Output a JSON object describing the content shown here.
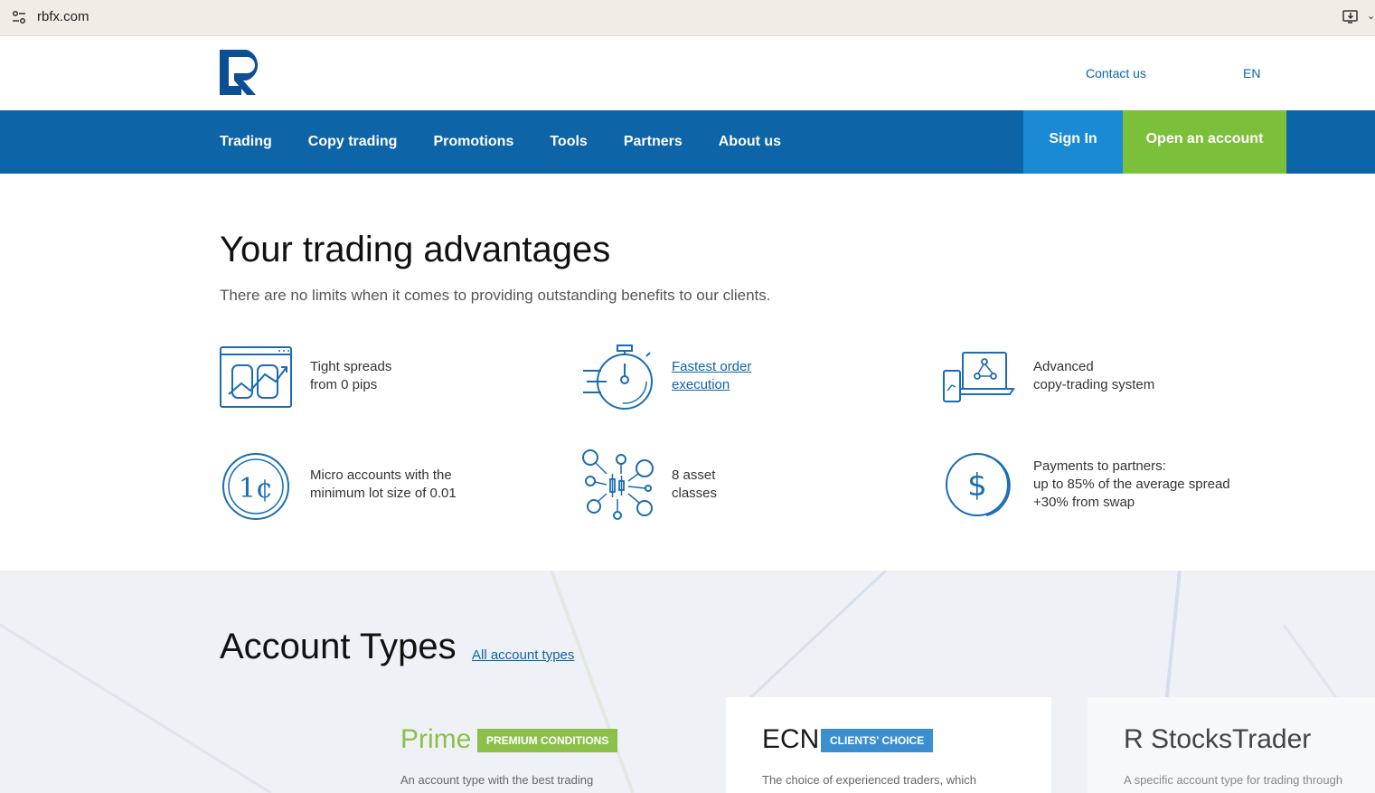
{
  "browser": {
    "url": "rbfx.com",
    "site_info_icon": "tune-icon",
    "install_icon": "install-app-icon"
  },
  "header": {
    "contact": "Contact us",
    "lang": "EN"
  },
  "nav": {
    "items": [
      "Trading",
      "Copy trading",
      "Promotions",
      "Tools",
      "Partners",
      "About us"
    ],
    "signin": "Sign In",
    "open_account": "Open an account"
  },
  "advantages": {
    "title": "Your trading advantages",
    "subtitle": "There are no limits when it comes to providing outstanding benefits to our clients.",
    "items": [
      {
        "line1": "Tight spreads",
        "line2": "from 0 pips",
        "icon": "spreads-chart-icon"
      },
      {
        "line1": "Fastest order",
        "line2": "execution",
        "icon": "stopwatch-icon",
        "link": true
      },
      {
        "line1": "Advanced",
        "line2": "copy-trading system",
        "icon": "devices-network-icon"
      },
      {
        "line1": "Micro accounts with the",
        "line2": "minimum lot size of 0.01",
        "icon": "cent-coin-icon"
      },
      {
        "line1": "8 asset",
        "line2": "classes",
        "icon": "asset-network-icon"
      },
      {
        "line1": "Payments to partners:",
        "line2": "up to 85% of the average spread",
        "line3": "+30% from swap",
        "icon": "dollar-coin-icon"
      }
    ]
  },
  "account_types": {
    "title": "Account Types",
    "all_link": "All account types",
    "cards": [
      {
        "name": "Prime",
        "badge": "PREMIUM CONDITIONS",
        "desc": "An account type with the best trading",
        "name_color": "#8cc04a",
        "badge_color": "#8cc04a"
      },
      {
        "name": "ECN",
        "badge": "CLIENTS' CHOICE",
        "desc": "The choice of experienced traders, which",
        "name_color": "#1a1a1a",
        "badge_color": "#3b8fd1"
      },
      {
        "name": "R StocksTrader",
        "badge": "",
        "desc": "A specific account type for trading through",
        "name_color": "#444444",
        "badge_color": ""
      }
    ]
  }
}
